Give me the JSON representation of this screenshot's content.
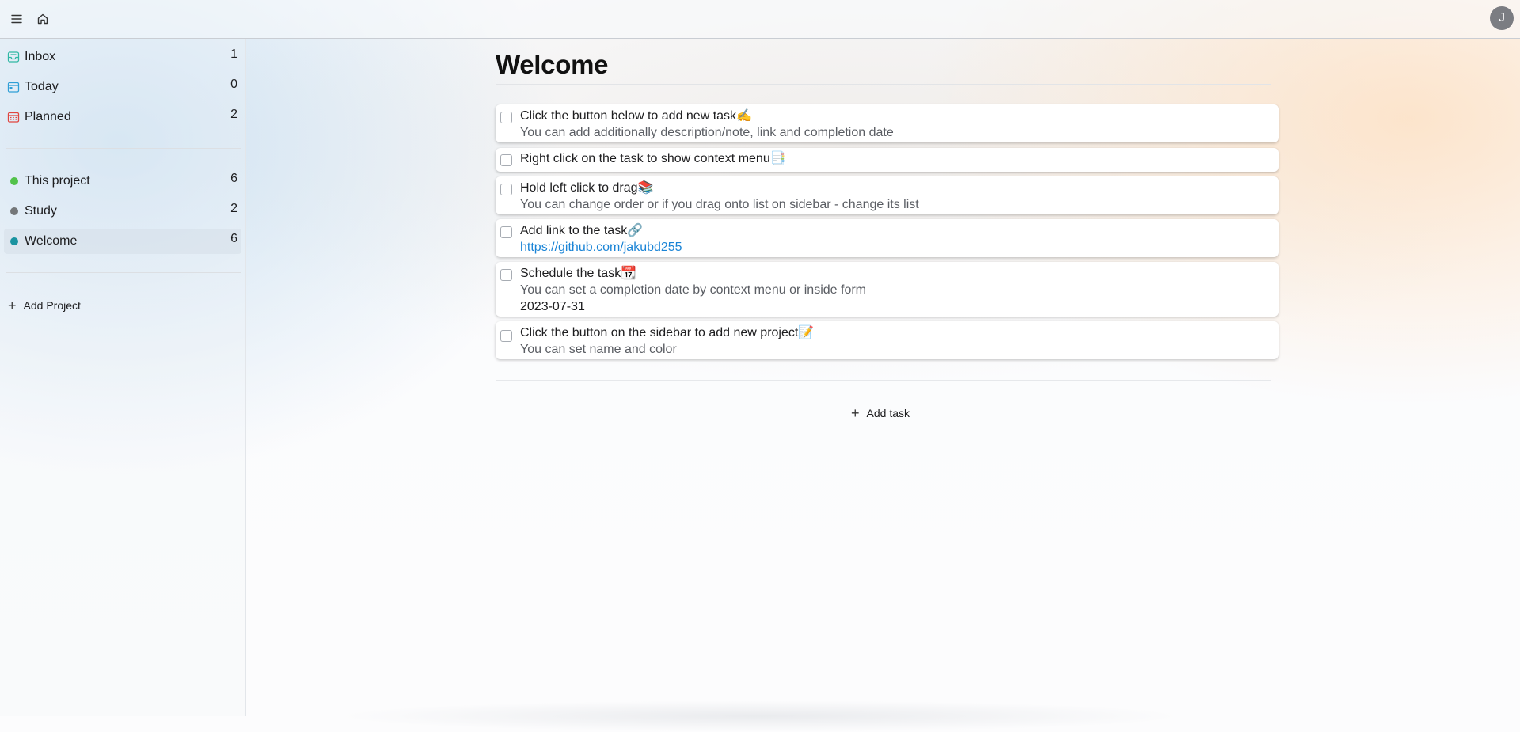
{
  "topbar": {
    "menu_icon": "hamburger-menu-icon",
    "home_icon": "home-icon",
    "avatar_initial": "J"
  },
  "sidebar": {
    "smart_lists": [
      {
        "label": "Inbox",
        "count": "1",
        "icon": "inbox-icon",
        "color": "#2fb8a4"
      },
      {
        "label": "Today",
        "count": "0",
        "icon": "calendar-today-icon",
        "color": "#2f9fd6"
      },
      {
        "label": "Planned",
        "count": "2",
        "icon": "calendar-grid-icon",
        "color": "#e0453f"
      }
    ],
    "projects": [
      {
        "label": "This project",
        "count": "6",
        "color": "#52c24a"
      },
      {
        "label": "Study",
        "count": "2",
        "color": "#747779"
      },
      {
        "label": "Welcome",
        "count": "6",
        "color": "#1a93a0",
        "active": true
      }
    ],
    "add_project_label": "Add Project"
  },
  "main": {
    "title": "Welcome",
    "tasks": [
      {
        "title": "Click the button below to add new task✍️",
        "desc": "You can add additionally description/note, link and completion date"
      },
      {
        "title": "Right click on the task to show context menu📑"
      },
      {
        "title": "Hold left click to drag📚",
        "desc": "You can change order or if you drag onto list on sidebar - change its list"
      },
      {
        "title": "Add link to the task🔗",
        "link": "https://github.com/jakubd255"
      },
      {
        "title": "Schedule the task📆",
        "desc": "You can set a completion date by context menu or inside form",
        "date": "2023-07-31"
      },
      {
        "title": "Click the button on the sidebar to add new project📝",
        "desc": "You can set name and color"
      }
    ],
    "add_task_label": "Add task"
  }
}
